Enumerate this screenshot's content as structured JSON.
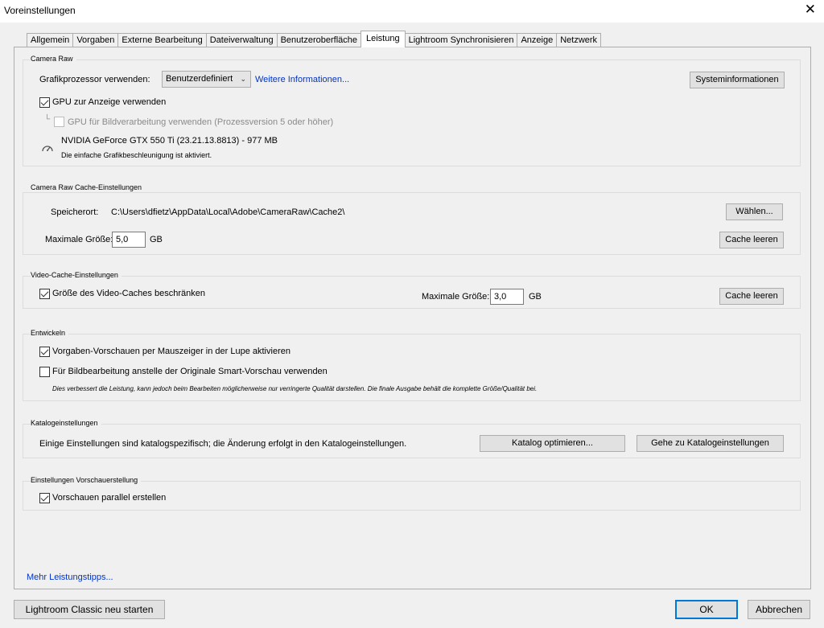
{
  "window": {
    "title": "Voreinstellungen",
    "close_glyph": "✕"
  },
  "tabs": [
    {
      "label": "Allgemein"
    },
    {
      "label": "Vorgaben"
    },
    {
      "label": "Externe Bearbeitung"
    },
    {
      "label": "Dateiverwaltung"
    },
    {
      "label": "Benutzeroberfläche"
    },
    {
      "label": "Leistung",
      "active": true
    },
    {
      "label": "Lightroom Synchronisieren"
    },
    {
      "label": "Anzeige"
    },
    {
      "label": "Netzwerk"
    }
  ],
  "camera_raw": {
    "group_label": "Camera Raw",
    "gpu_label": "Grafikprozessor verwenden:",
    "gpu_select_value": "Benutzerdefiniert",
    "more_info_link": "Weitere Informationen...",
    "system_info_button": "Systeminformationen",
    "gpu_display_label": "GPU zur Anzeige verwenden",
    "gpu_display_checked": true,
    "tree_glyph": "└",
    "gpu_processing_label": "GPU für Bildverarbeitung verwenden (Prozessversion 5 oder höher)",
    "gpu_processing_checked": false,
    "gpu_name": "NVIDIA GeForce GTX 550 Ti (23.21.13.8813) - 977 MB",
    "gpu_status": "Die einfache Grafikbeschleunigung ist aktiviert."
  },
  "cache": {
    "group_label": "Camera Raw Cache-Einstellungen",
    "location_label": "Speicherort:",
    "location_value": "C:\\Users\\dfietz\\AppData\\Local\\Adobe\\CameraRaw\\Cache2\\",
    "choose_button": "Wählen...",
    "max_size_label": "Maximale Größe:",
    "max_size_value": "5,0",
    "unit": "GB",
    "clear_button": "Cache leeren"
  },
  "video_cache": {
    "group_label": "Video-Cache-Einstellungen",
    "limit_label": "Größe des Video-Caches beschränken",
    "limit_checked": true,
    "max_size_label": "Maximale Größe:",
    "max_size_value": "3,0",
    "unit": "GB",
    "clear_button": "Cache leeren"
  },
  "develop": {
    "group_label": "Entwickeln",
    "preset_preview_label": "Vorgaben-Vorschauen per Mauszeiger in der Lupe aktivieren",
    "preset_preview_checked": true,
    "smart_preview_label": "Für Bildbearbeitung anstelle der Originale Smart-Vorschau verwenden",
    "smart_preview_checked": false,
    "note": "Dies verbessert die Leistung, kann jedoch beim Bearbeiten möglicherweise nur verringerte Qualität darstellen. Die finale Ausgabe behält die komplette Größe/Qualität bei."
  },
  "catalog": {
    "group_label": "Katalogeinstellungen",
    "description": "Einige Einstellungen sind katalogspezifisch; die Änderung erfolgt in den Katalogeinstellungen.",
    "optimize_button": "Katalog optimieren...",
    "goto_button": "Gehe zu Katalogeinstellungen"
  },
  "preview": {
    "group_label": "Einstellungen Vorschauerstellung",
    "parallel_label": "Vorschauen parallel erstellen",
    "parallel_checked": true
  },
  "more_tips_link": "Mehr Leistungstipps...",
  "footer": {
    "restart_button": "Lightroom Classic neu starten",
    "ok_button": "OK",
    "cancel_button": "Abbrechen"
  },
  "colors": {
    "accent": "#0078d7",
    "link": "#0033cc",
    "background": "#f0f0f0"
  }
}
